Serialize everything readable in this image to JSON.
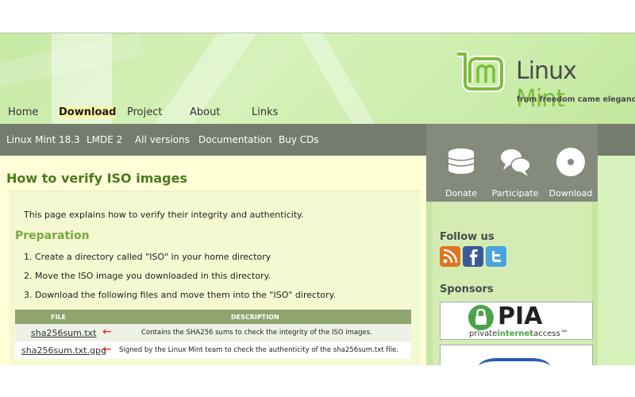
{
  "header": {
    "logo": {
      "text_linux": "Linux",
      "text_mint": "Mint",
      "tagline": "from freedom came elegance"
    },
    "nav": [
      {
        "label": "Home"
      },
      {
        "label": "Download",
        "active": true
      },
      {
        "label": "Project"
      },
      {
        "label": "About"
      },
      {
        "label": "Links"
      }
    ]
  },
  "subnav": [
    {
      "label": "Linux Mint 18.3"
    },
    {
      "label": "LMDE 2"
    },
    {
      "label": "All versions"
    },
    {
      "label": "Documentation"
    },
    {
      "label": "Buy CDs"
    }
  ],
  "quicklinks": [
    {
      "label": "Donate",
      "icon": "coins-icon"
    },
    {
      "label": "Participate",
      "icon": "chat-bubbles-icon"
    },
    {
      "label": "Download",
      "icon": "disc-icon"
    }
  ],
  "content": {
    "title": "How to verify ISO images",
    "intro": "This page explains how to verify their integrity and authenticity.",
    "section_title": "Preparation",
    "steps": [
      "1. Create a directory called \"ISO\" in your home directory",
      "2. Move the ISO image you downloaded in this directory.",
      "3. Download the following files and move them into the \"ISO\" directory."
    ],
    "table": {
      "headers": [
        "FILE",
        "DESCRIPTION"
      ],
      "rows": [
        {
          "file": "sha256sum.txt",
          "arrow": "←",
          "description": "Contains the SHA256 sums to check the integrity of the ISO images."
        },
        {
          "file": "sha256sum.txt.gpg",
          "arrow": "←",
          "description": "Signed by the Linux Mint team to check the authenticity of the sha256sum.txt file."
        }
      ]
    }
  },
  "sidebar": {
    "follow_title": "Follow us",
    "social": [
      {
        "icon": "rss-icon",
        "color": "#e2731f"
      },
      {
        "icon": "facebook-icon",
        "color": "#3b5998"
      },
      {
        "icon": "twitter-icon",
        "color": "#4aa3df"
      }
    ],
    "sponsors_title": "Sponsors",
    "sponsor1": {
      "name": "PIA",
      "tagline_a": "private",
      "tagline_b": "internet",
      "tagline_c": "access™"
    }
  },
  "colors": {
    "accent_green": "#4a7a1f",
    "section_green": "#79a83f",
    "subnav_gray": "#757c6d",
    "active_nav": "#f6f7a8"
  }
}
